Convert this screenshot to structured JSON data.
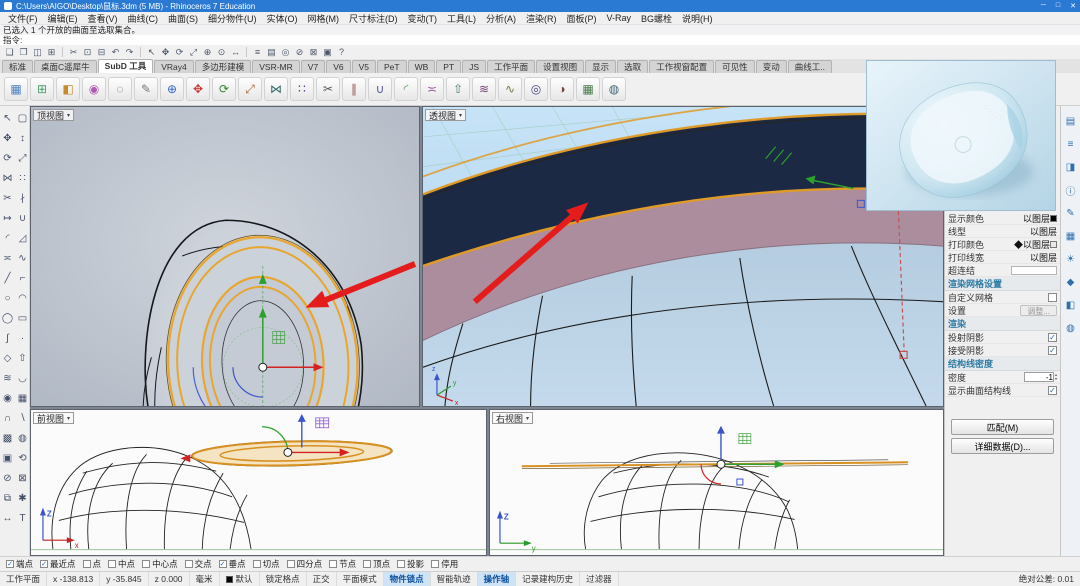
{
  "window": {
    "title": "C:\\Users\\AIGO\\Desktop\\鼠标.3dm (5 MB) - Rhinoceros 7 Education",
    "controls": [
      {
        "name": "minimize",
        "glyph": "─"
      },
      {
        "name": "maximize",
        "glyph": "□"
      },
      {
        "name": "close",
        "glyph": "✕"
      }
    ]
  },
  "menu": {
    "items": [
      "文件(F)",
      "编辑(E)",
      "查看(V)",
      "曲线(C)",
      "曲面(S)",
      "细分物件(U)",
      "实体(O)",
      "网格(M)",
      "尺寸标注(D)",
      "变动(T)",
      "工具(L)",
      "分析(A)",
      "渲染(R)",
      "面板(P)",
      "V-Ray",
      "BG螺栓",
      "说明(H)"
    ]
  },
  "command": {
    "history": "已选入 1 个开放的曲面至选取集合。",
    "prompt_label": "指令:"
  },
  "toolbar_top": {
    "icons": [
      {
        "name": "new-file",
        "glyph": "❏"
      },
      {
        "name": "open-file",
        "glyph": "❐"
      },
      {
        "name": "save",
        "glyph": "◫"
      },
      {
        "name": "print",
        "glyph": "⊞"
      },
      {
        "sep": true
      },
      {
        "name": "cut",
        "glyph": "✂"
      },
      {
        "name": "copy",
        "glyph": "⊡"
      },
      {
        "name": "paste",
        "glyph": "⊟"
      },
      {
        "name": "undo",
        "glyph": "↶"
      },
      {
        "name": "redo",
        "glyph": "↷"
      },
      {
        "sep": true
      },
      {
        "name": "select",
        "glyph": "↖"
      },
      {
        "name": "move",
        "glyph": "✥"
      },
      {
        "name": "rotate",
        "glyph": "⟳"
      },
      {
        "name": "scale",
        "glyph": "⤢"
      },
      {
        "name": "zoom-window",
        "glyph": "⊕"
      },
      {
        "name": "zoom-extents",
        "glyph": "⊙"
      },
      {
        "name": "pan",
        "glyph": "↔"
      },
      {
        "sep": true
      },
      {
        "name": "layers",
        "glyph": "≡"
      },
      {
        "name": "properties",
        "glyph": "▤"
      },
      {
        "name": "object-snap",
        "glyph": "◎"
      },
      {
        "name": "hide-object",
        "glyph": "⊘"
      },
      {
        "name": "lock-object",
        "glyph": "⊠"
      },
      {
        "name": "show-object",
        "glyph": "▣"
      },
      {
        "name": "help",
        "glyph": "?"
      }
    ]
  },
  "tab_bar": {
    "tabs": [
      {
        "label": "标准",
        "active": false
      },
      {
        "label": "桌面C遥犀牛",
        "active": false
      },
      {
        "label": "SubD 工具",
        "active": true
      },
      {
        "label": "VRay4",
        "active": false
      },
      {
        "label": "多边形建模",
        "active": false
      },
      {
        "label": "VSR-MR",
        "active": false
      },
      {
        "label": "V7",
        "active": false
      },
      {
        "label": "V6",
        "active": false
      },
      {
        "label": "V5",
        "active": false
      },
      {
        "label": "PeT",
        "active": false
      },
      {
        "label": "WB",
        "active": false
      },
      {
        "label": "PT",
        "active": false
      },
      {
        "label": "JS",
        "active": false
      },
      {
        "label": "工作平面",
        "active": false
      },
      {
        "label": "设置视图",
        "active": false
      },
      {
        "label": "显示",
        "active": false
      },
      {
        "label": "选取",
        "active": false
      },
      {
        "label": "工作视窗配置",
        "active": false
      },
      {
        "label": "可见性",
        "active": false
      },
      {
        "label": "变动",
        "active": false
      },
      {
        "label": "曲线工..",
        "active": false
      }
    ]
  },
  "toolbar_main": {
    "icons": [
      {
        "name": "cplane-tool",
        "glyph": "▦",
        "color": "#4a7fc1"
      },
      {
        "name": "grid-toggle",
        "glyph": "⊞",
        "color": "#4a9f6e"
      },
      {
        "name": "shaded-view",
        "glyph": "◧",
        "color": "#c98a2e"
      },
      {
        "name": "rendered-view",
        "glyph": "◉",
        "color": "#b05ab0"
      },
      {
        "name": "wireframe-view",
        "glyph": "◌",
        "color": "#556677"
      },
      {
        "name": "pen-view",
        "glyph": "✎",
        "color": "#777777"
      },
      {
        "name": "zoom-selected",
        "glyph": "⊕",
        "color": "#3366cc"
      },
      {
        "name": "move-tool",
        "glyph": "✥",
        "color": "#cc3333"
      },
      {
        "name": "rotate-tool",
        "glyph": "⟳",
        "color": "#338833"
      },
      {
        "name": "scale-tool",
        "glyph": "⤢",
        "color": "#aa6633"
      },
      {
        "name": "mirror-tool",
        "glyph": "⋈",
        "color": "#336666"
      },
      {
        "name": "array-tool",
        "glyph": "∷",
        "color": "#663399"
      },
      {
        "name": "trim-tool",
        "glyph": "✂",
        "color": "#555555"
      },
      {
        "name": "split-tool",
        "glyph": "∥",
        "color": "#995555"
      },
      {
        "name": "join-tool",
        "glyph": "∪",
        "color": "#555599"
      },
      {
        "name": "fillet-tool",
        "glyph": "◜",
        "color": "#559955"
      },
      {
        "name": "offset-tool",
        "glyph": "≍",
        "color": "#995599"
      },
      {
        "name": "extrude-tool",
        "glyph": "⇧",
        "color": "#447777"
      },
      {
        "name": "loft-tool",
        "glyph": "≋",
        "color": "#774477"
      },
      {
        "name": "sweep-tool",
        "glyph": "∿",
        "color": "#777744"
      },
      {
        "name": "revolve-tool",
        "glyph": "◎",
        "color": "#444477"
      },
      {
        "name": "boolean-tool",
        "glyph": "◑",
        "color": "#774444"
      },
      {
        "name": "mesh-tool",
        "glyph": "▦",
        "color": "#447744"
      },
      {
        "name": "subd-tool",
        "glyph": "◍",
        "color": "#446677"
      }
    ]
  },
  "left_toolbar": {
    "icons": [
      {
        "name": "pointer",
        "glyph": "↖"
      },
      {
        "name": "area-select",
        "glyph": "▢"
      },
      {
        "name": "move",
        "glyph": "✥"
      },
      {
        "name": "nudge",
        "glyph": "↕"
      },
      {
        "name": "rotate",
        "glyph": "⟳"
      },
      {
        "name": "scale",
        "glyph": "⤢"
      },
      {
        "name": "mirror",
        "glyph": "⋈"
      },
      {
        "name": "array",
        "glyph": "∷"
      },
      {
        "name": "trim",
        "glyph": "✂"
      },
      {
        "name": "split",
        "glyph": "∤"
      },
      {
        "name": "extend",
        "glyph": "↦"
      },
      {
        "name": "join",
        "glyph": "∪"
      },
      {
        "name": "fillet",
        "glyph": "◜"
      },
      {
        "name": "chamfer",
        "glyph": "◿"
      },
      {
        "name": "offset",
        "glyph": "≍"
      },
      {
        "name": "blend",
        "glyph": "∿"
      },
      {
        "name": "line",
        "glyph": "╱"
      },
      {
        "name": "polyline",
        "glyph": "⌐"
      },
      {
        "name": "circle",
        "glyph": "○"
      },
      {
        "name": "arc",
        "glyph": "◠"
      },
      {
        "name": "ellipse",
        "glyph": "◯"
      },
      {
        "name": "rectangle",
        "glyph": "▭"
      },
      {
        "name": "curve",
        "glyph": "∫"
      },
      {
        "name": "point",
        "glyph": "·"
      },
      {
        "name": "surface",
        "glyph": "◇"
      },
      {
        "name": "extrude",
        "glyph": "⇧"
      },
      {
        "name": "loft",
        "glyph": "≋"
      },
      {
        "name": "sweep",
        "glyph": "◡"
      },
      {
        "name": "revolve",
        "glyph": "◉"
      },
      {
        "name": "patch",
        "glyph": "▦"
      },
      {
        "name": "boolean-union",
        "glyph": "∩"
      },
      {
        "name": "boolean-difference",
        "glyph": "∖"
      },
      {
        "name": "mesh",
        "glyph": "▩"
      },
      {
        "name": "subd",
        "glyph": "◍"
      },
      {
        "name": "cage-edit",
        "glyph": "▣"
      },
      {
        "name": "history",
        "glyph": "⟲"
      },
      {
        "name": "hide",
        "glyph": "⊘"
      },
      {
        "name": "lock",
        "glyph": "⊠"
      },
      {
        "name": "group",
        "glyph": "⧉"
      },
      {
        "name": "explode",
        "glyph": "✱"
      },
      {
        "name": "dimension",
        "glyph": "↔"
      },
      {
        "name": "text",
        "glyph": "Τ"
      }
    ]
  },
  "right_tabs": {
    "icons": [
      {
        "name": "properties-panel-tab",
        "glyph": "▤"
      },
      {
        "name": "layers-panel-tab",
        "glyph": "≡"
      },
      {
        "name": "display-panel-tab",
        "glyph": "◨"
      },
      {
        "name": "help-panel-tab",
        "glyph": "ⓘ"
      },
      {
        "name": "notes-panel-tab",
        "glyph": "✎"
      },
      {
        "name": "libraries-panel-tab",
        "glyph": "▦"
      },
      {
        "name": "sun-panel-tab",
        "glyph": "☀"
      },
      {
        "name": "materials-panel-tab",
        "glyph": "◆"
      },
      {
        "name": "rendering-panel-tab",
        "glyph": "◧"
      },
      {
        "name": "web-panel-tab",
        "glyph": "◍"
      }
    ]
  },
  "viewports": {
    "menu_arrow": "▾",
    "top": {
      "label": "顶视图"
    },
    "perspective": {
      "label": "透视图"
    },
    "front": {
      "label": "前视图"
    },
    "right": {
      "label": "右视图"
    },
    "axis": {
      "x": "x",
      "y": "y",
      "z": "z",
      "z_upper": "Z"
    }
  },
  "properties_panel": {
    "spinner_up": "▴",
    "spinner_down": "▾",
    "rows": [
      {
        "type": "prop",
        "label": "显示颜色",
        "value": "以图层",
        "swatch": "#000000"
      },
      {
        "type": "prop",
        "label": "线型",
        "value": "以图层"
      },
      {
        "type": "prop",
        "label": "打印颜色",
        "value": "◆以图层",
        "swatch": "#e8e8e8"
      },
      {
        "type": "prop",
        "label": "打印线宽",
        "value": "以图层"
      },
      {
        "type": "input",
        "label": "超连结",
        "value": ""
      },
      {
        "type": "section",
        "label": "渲染网格设置"
      },
      {
        "type": "check",
        "label": "自定义网格",
        "checked": false
      },
      {
        "type": "propbtn",
        "label": "设置",
        "value": "调整...",
        "disabled": true
      },
      {
        "type": "section",
        "label": "渲染"
      },
      {
        "type": "check",
        "label": "投射阴影",
        "checked": true
      },
      {
        "type": "check",
        "label": "接受阴影",
        "checked": true
      },
      {
        "type": "section",
        "label": "结构线密度"
      },
      {
        "type": "spinner",
        "label": "密度",
        "value": "-1"
      },
      {
        "type": "check",
        "label": "显示曲面结构线",
        "checked": true
      },
      {
        "type": "button",
        "label": "匹配(M)",
        "gap": true
      },
      {
        "type": "button",
        "label": "详细数据(D)..."
      }
    ]
  },
  "osnap_bar": {
    "items": [
      {
        "label": "端点",
        "checked": true
      },
      {
        "label": "最近点",
        "checked": true
      },
      {
        "label": "点",
        "checked": false
      },
      {
        "label": "中点",
        "checked": false
      },
      {
        "label": "中心点",
        "checked": false
      },
      {
        "label": "交点",
        "checked": false
      },
      {
        "label": "垂点",
        "checked": true
      },
      {
        "label": "切点",
        "checked": false
      },
      {
        "label": "四分点",
        "checked": false
      },
      {
        "label": "节点",
        "checked": false
      },
      {
        "label": "顶点",
        "checked": false
      },
      {
        "label": "投影",
        "checked": false
      },
      {
        "label": "停用",
        "checked": false
      }
    ]
  },
  "status_bar": {
    "cplane_button": "工作平面",
    "coords": [
      {
        "label": "x",
        "value": "-138.813"
      },
      {
        "label": "y",
        "value": "-35.845"
      },
      {
        "label": "z",
        "value": "0.000"
      }
    ],
    "units": "毫米",
    "layer": "默认",
    "toggles": [
      {
        "label": "锁定格点",
        "active": false
      },
      {
        "label": "正交",
        "active": false
      },
      {
        "label": "平面模式",
        "active": false
      },
      {
        "label": "物件锁点",
        "active": true
      },
      {
        "label": "智能轨迹",
        "active": false
      },
      {
        "label": "操作轴",
        "active": true
      },
      {
        "label": "记录建构历史",
        "active": false
      },
      {
        "label": "过滤器",
        "active": false
      }
    ],
    "tolerance": "绝对公差: 0.01"
  }
}
